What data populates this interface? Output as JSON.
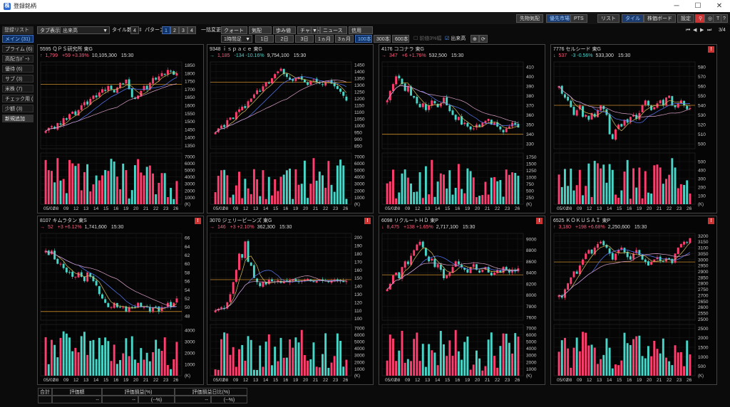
{
  "window": {
    "title": "登録銘柄"
  },
  "toolbar": {
    "buttons": [
      {
        "label": "先物気配",
        "active": false
      },
      {
        "label": "優先市場",
        "active": true
      },
      {
        "label": "PTS",
        "active": false
      },
      {
        "label": "リスト",
        "active": false
      },
      {
        "label": "タイル",
        "active": true
      },
      {
        "label": "株価ボード",
        "active": false
      },
      {
        "label": "設定",
        "active": false
      }
    ],
    "page": "3/4"
  },
  "sidebar": {
    "header": "登録リスト",
    "items": [
      {
        "label": "メイン (31)",
        "selected": true
      },
      {
        "label": "プライム (6)",
        "selected": false
      },
      {
        "label": "高配当ﾎﾟｰﾄ",
        "selected": false
      },
      {
        "label": "優待 (6)",
        "selected": false
      },
      {
        "label": "サブ (3)",
        "selected": false
      },
      {
        "label": "米株 (7)",
        "selected": false
      },
      {
        "label": "チェック用 (",
        "selected": false
      },
      {
        "label": "少額 (3)",
        "selected": false
      }
    ],
    "add": "新規追加"
  },
  "controls": {
    "tab_label": "タブ表示",
    "sort_value": "出来高",
    "tile_label": "タイル数",
    "tile_count": "4",
    "pattern_label": "パターン",
    "patterns": [
      "1",
      "2",
      "3",
      "4"
    ],
    "pattern_selected": 0,
    "bulk_change": "一括変更",
    "quote": "クォート",
    "kehai": "気配",
    "tick": "歩み値",
    "chart": "チャート",
    "news": "ニュース",
    "credit": "信用",
    "interval": "1時間足",
    "periods": [
      "1日",
      "2日",
      "3日",
      "1ヵ月",
      "3ヵ月",
      "100本",
      "300本",
      "600本"
    ],
    "period_selected": 5,
    "check_prev": "前値3%幅",
    "check_volume": "出来高"
  },
  "x_axis": [
    "05/02",
    "08",
    "09",
    "12",
    "13",
    "14",
    "15",
    "16",
    "19",
    "20",
    "21",
    "22",
    "23",
    "26"
  ],
  "panels": [
    {
      "code": "5595",
      "name": "ＱＰＳ研究所",
      "market": "東G",
      "arrow": "↑",
      "price": "1,799",
      "chg": "+59 +3.39%",
      "vol": "10,105,300",
      "time": "15:30",
      "dir": "up",
      "warn": false,
      "yticks": [
        "1850",
        "1800",
        "1750",
        "1700",
        "1650",
        "1600",
        "1550",
        "1500",
        "1450",
        "1400",
        "1350"
      ],
      "vticks": [
        "7000",
        "6000",
        "5000",
        "4000",
        "3000",
        "2000",
        "1000"
      ],
      "chart_data": {
        "type": "candlestick",
        "ylim": [
          1330,
          1870
        ],
        "base_line": 1730,
        "vol_max": 7500,
        "closes": [
          1440,
          1460,
          1470,
          1455,
          1490,
          1480,
          1520,
          1510,
          1545,
          1560,
          1540,
          1570,
          1600,
          1620,
          1605,
          1640,
          1660,
          1650,
          1680,
          1700,
          1690,
          1720,
          1700,
          1680,
          1710,
          1740,
          1735,
          1760,
          1700,
          1650,
          1640,
          1660,
          1690,
          1720,
          1700,
          1740,
          1770,
          1760,
          1780,
          1800,
          1790,
          1820,
          1810,
          1790,
          1799
        ]
      }
    },
    {
      "code": "9348",
      "name": "ｉｓｐａｃｅ",
      "market": "東G",
      "arrow": "→",
      "price": "1,185",
      "chg": "-134 -10.16%",
      "vol": "9,754,100",
      "time": "15:30",
      "dir": "down",
      "warn": false,
      "yticks": [
        "1450",
        "1400",
        "1350",
        "1300",
        "1250",
        "1200",
        "1150",
        "1100",
        "1050",
        "1000",
        "950",
        "900",
        "850"
      ],
      "vticks": [
        "7000",
        "6000",
        "5000",
        "4000",
        "3000",
        "2000",
        "1000"
      ],
      "chart_data": {
        "type": "candlestick",
        "ylim": [
          830,
          1470
        ],
        "base_line": 1320,
        "vol_max": 7500,
        "closes": [
          950,
          980,
          1000,
          990,
          1040,
          1060,
          1050,
          1100,
          1120,
          1140,
          1130,
          1180,
          1200,
          1230,
          1260,
          1250,
          1290,
          1320,
          1310,
          1350,
          1380,
          1400,
          1420,
          1380,
          1360,
          1340,
          1330,
          1350,
          1360,
          1340,
          1320,
          1300,
          1330,
          1340,
          1320,
          1310,
          1300,
          1320,
          1330,
          1310,
          1290,
          1270,
          1250,
          1220,
          1185
        ]
      }
    },
    {
      "code": "4176",
      "name": "ココナラ",
      "market": "東G",
      "arrow": "→",
      "price": "347",
      "chg": "+6 +1.76%",
      "vol": "532,500",
      "time": "15:30",
      "dir": "up",
      "warn": false,
      "yticks": [
        "410",
        "400",
        "390",
        "380",
        "370",
        "360",
        "350",
        "340",
        "330"
      ],
      "vticks": [
        "1750",
        "1500",
        "1250",
        "1000",
        "750",
        "500",
        "250"
      ],
      "chart_data": {
        "type": "candlestick",
        "ylim": [
          325,
          415
        ],
        "base_line": 340,
        "vol_max": 1900,
        "closes": [
          375,
          385,
          392,
          400,
          398,
          392,
          385,
          390,
          380,
          378,
          372,
          368,
          372,
          365,
          370,
          375,
          372,
          368,
          372,
          378,
          370,
          364,
          360,
          355,
          358,
          350,
          352,
          348,
          345,
          346,
          350,
          348,
          352,
          354,
          356,
          350,
          352,
          348,
          345,
          342,
          346,
          348,
          352,
          350,
          347
        ]
      }
    },
    {
      "code": "7776",
      "name": "セルシード",
      "market": "東G",
      "arrow": "↓",
      "price": "537",
      "chg": "-3 -0.56%",
      "vol": "533,300",
      "time": "15:30",
      "dir": "down",
      "warn": true,
      "yticks": [
        "580",
        "570",
        "560",
        "550",
        "540",
        "530",
        "520",
        "510",
        "500"
      ],
      "vticks": [
        "500",
        "400",
        "300",
        "200",
        "100"
      ],
      "chart_data": {
        "type": "candlestick",
        "ylim": [
          495,
          585
        ],
        "base_line": 540,
        "vol_max": 600,
        "closes": [
          560,
          552,
          548,
          545,
          538,
          530,
          535,
          540,
          528,
          530,
          525,
          532,
          528,
          535,
          540,
          536,
          530,
          510,
          505,
          515,
          520,
          518,
          525,
          522,
          528,
          530,
          526,
          532,
          540,
          545,
          540,
          535,
          538,
          542,
          545,
          540,
          548,
          550,
          540,
          538,
          542,
          545,
          540,
          536,
          537
        ]
      }
    },
    {
      "code": "8107",
      "name": "キムラタン",
      "market": "東S",
      "arrow": "→",
      "price": "52",
      "chg": "+3 +6.12%",
      "vol": "1,741,600",
      "time": "15:30",
      "dir": "up",
      "warn": true,
      "yticks": [
        "66",
        "64",
        "62",
        "60",
        "58",
        "56",
        "54",
        "52",
        "50",
        "48"
      ],
      "vticks": [
        "4000",
        "3000",
        "2000",
        "1000"
      ],
      "chart_data": {
        "type": "candlestick",
        "ylim": [
          47,
          67
        ],
        "base_line": 49,
        "vol_max": 4500,
        "closes": [
          63,
          62,
          63,
          61,
          60,
          60,
          59,
          58,
          58,
          57,
          57,
          58,
          57,
          56,
          58,
          57,
          56,
          55,
          53,
          52,
          51,
          50,
          50,
          51,
          50,
          50,
          50,
          49,
          50,
          50,
          50,
          51,
          50,
          50,
          50,
          49,
          50,
          50,
          49,
          50,
          50,
          51,
          50,
          51,
          52
        ]
      }
    },
    {
      "code": "3070",
      "name": "ジェリービーンズ",
      "market": "東G",
      "arrow": "→",
      "price": "146",
      "chg": "+3 +2.10%",
      "vol": "362,300",
      "time": "15:30",
      "dir": "up",
      "warn": true,
      "yticks": [
        "200",
        "190",
        "180",
        "170",
        "160",
        "150",
        "140",
        "130",
        "120",
        "110",
        "100"
      ],
      "vticks": [
        "7000",
        "6000",
        "5000",
        "4000",
        "3000",
        "2000",
        "1000"
      ],
      "chart_data": {
        "type": "candlestick",
        "ylim": [
          98,
          205
        ],
        "base_line": 148,
        "vol_max": 7500,
        "closes": [
          110,
          112,
          114,
          113,
          120,
          130,
          145,
          160,
          180,
          175,
          195,
          170,
          165,
          150,
          145,
          140,
          145,
          142,
          148,
          146,
          145,
          147,
          144,
          146,
          145,
          147,
          148,
          146,
          145,
          147,
          148,
          149,
          146,
          145,
          147,
          148,
          147,
          146,
          145,
          147,
          148,
          147,
          146,
          145,
          146
        ]
      }
    },
    {
      "code": "6098",
      "name": "リクルートＨＤ",
      "market": "東P",
      "arrow": "↓",
      "price": "8,475",
      "chg": "+138 +1.65%",
      "vol": "2,717,100",
      "time": "15:30",
      "dir": "up",
      "warn": true,
      "yticks": [
        "9000",
        "8800",
        "8600",
        "8400",
        "8200",
        "8000",
        "7800",
        "7600"
      ],
      "vticks": [
        "7000",
        "6000",
        "5000",
        "4000",
        "3000",
        "2000",
        "1000"
      ],
      "chart_data": {
        "type": "candlestick",
        "ylim": [
          7550,
          9100
        ],
        "base_line": 8360,
        "vol_max": 7500,
        "closes": [
          8100,
          8200,
          8350,
          8400,
          8300,
          8500,
          8600,
          8550,
          8700,
          8800,
          8900,
          8950,
          8850,
          8700,
          8600,
          8650,
          8500,
          8550,
          8450,
          8300,
          8350,
          8400,
          8500,
          8600,
          8550,
          8500,
          8450,
          8400,
          8500,
          8550,
          8450,
          8400,
          8450,
          8500,
          8400,
          8350,
          8400,
          8450,
          8400,
          8500,
          8450,
          8400,
          8450,
          8420,
          8475
        ]
      }
    },
    {
      "code": "6525",
      "name": "ＫＯＫＵＳＡＩ",
      "market": "東P",
      "arrow": "↑",
      "price": "3,180",
      "chg": "+198 +6.68%",
      "vol": "2,250,600",
      "time": "15:30",
      "dir": "up",
      "warn": true,
      "yticks": [
        "3200",
        "3150",
        "3100",
        "3050",
        "3000",
        "2950",
        "2900",
        "2850",
        "2800",
        "2750",
        "2700",
        "2650",
        "2600",
        "2550",
        "2500"
      ],
      "vticks": [
        "2500",
        "2000",
        "1500",
        "1000",
        "500"
      ],
      "chart_data": {
        "type": "candlestick",
        "ylim": [
          2490,
          3220
        ],
        "base_line": 2980,
        "vol_max": 2700,
        "closes": [
          2700,
          2680,
          2750,
          2800,
          2850,
          2900,
          2880,
          2950,
          3000,
          3050,
          3080,
          3050,
          3100,
          3130,
          3150,
          3120,
          3100,
          3050,
          3000,
          3050,
          3080,
          3100,
          3060,
          3020,
          3000,
          3050,
          3080,
          3040,
          3000,
          2980,
          2950,
          2980,
          3000,
          3020,
          2990,
          2980,
          3010,
          3000,
          2970,
          3050,
          3100,
          3130,
          3150,
          3140,
          3180
        ]
      }
    }
  ],
  "footer": {
    "total_label": "合計",
    "headers": [
      "評価額",
      "評価損益(%)",
      "評価損益日比(%)"
    ],
    "values": [
      "--",
      "--",
      "(--%)",
      "--",
      "(--%)"
    ]
  }
}
